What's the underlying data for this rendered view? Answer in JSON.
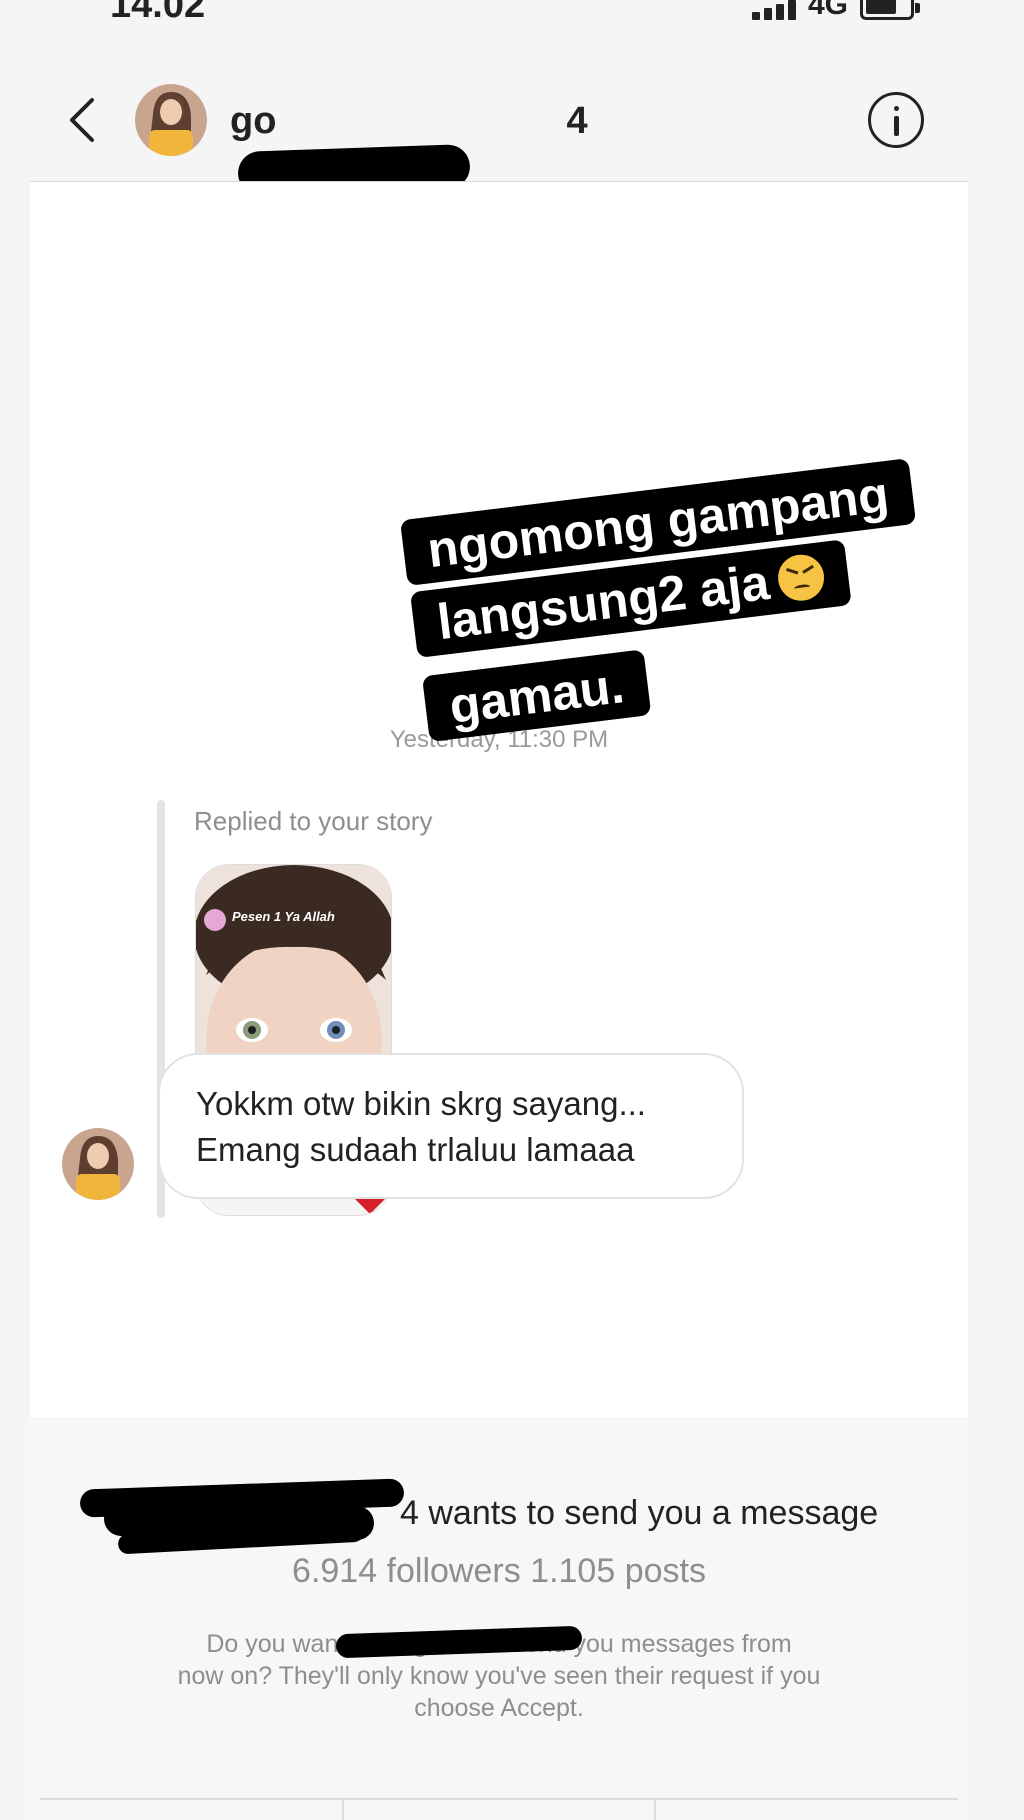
{
  "status_bar": {
    "time": "14.02",
    "network": "4G"
  },
  "header": {
    "username_visible": "go",
    "username_tail": "4"
  },
  "conversation": {
    "overlay_text": [
      "ngomong gampang",
      "langsung2 aja",
      "gamau."
    ],
    "timestamp": "Yesterday, 11:30 PM",
    "reply_label": "Replied to your story",
    "story_caption": "Pesen 1 Ya Allah",
    "message_lines": [
      "Yokkm otw bikin skrg sayang...",
      "Emang sudaah trlaluu lamaaa"
    ]
  },
  "request": {
    "title_tail": "4 wants to send you a message",
    "stats": "6.914 followers 1.105 posts",
    "body_lines": [
      "Do you want to let g                 send you messages from",
      "now on? They'll only know you've seen their request if you",
      "choose Accept."
    ]
  },
  "colors": {
    "accent": "#000000",
    "muted_text": "#8e8e8e",
    "bubble_border": "#e2e2e2"
  },
  "icons": {
    "back": "chevron-left-icon",
    "info": "info-circle-icon"
  }
}
